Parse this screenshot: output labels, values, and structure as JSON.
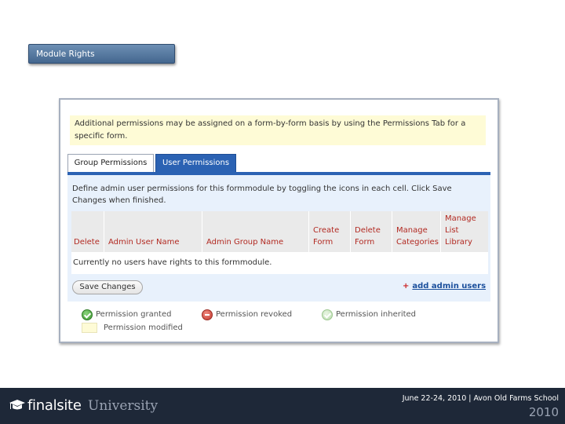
{
  "section_label": "Module Rights",
  "notice": "Additional permissions may be assigned on a form-by-form basis by using the Permissions Tab for a specific form.",
  "tabs": [
    {
      "label": "Group Permissions",
      "active": false
    },
    {
      "label": "User Permissions",
      "active": true
    }
  ],
  "description": "Define admin user permissions for this formmodule by toggling the icons in each cell. Click Save Changes when finished.",
  "table": {
    "columns": [
      "Delete",
      "Admin User Name",
      "Admin Group Name",
      "Create Form",
      "Delete Form",
      "Manage Categories",
      "Manage List Library"
    ],
    "empty_message": "Currently no users have rights to this formmodule."
  },
  "actions": {
    "save_label": "Save Changes",
    "add_plus": "+",
    "add_label": "add admin users"
  },
  "legend": {
    "granted": "Permission granted",
    "revoked": "Permission revoked",
    "inherited": "Permission inherited",
    "modified": "Permission modified"
  },
  "footer": {
    "brand_name": "finalsite",
    "brand_suffix": "University",
    "event": "June 22-24, 2010 | Avon Old Farms School",
    "year": "2010"
  },
  "colors": {
    "tab_active": "#2b62b3",
    "header_text": "#b22a22",
    "notice_bg": "#fefbd6",
    "content_bg": "#e8f1fc",
    "footer_bg": "#1e2838"
  }
}
